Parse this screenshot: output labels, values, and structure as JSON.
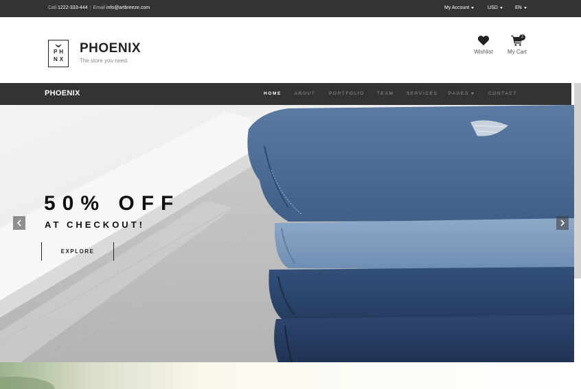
{
  "topbar": {
    "call_label": "Call",
    "phone": "1222-333-444",
    "email_label": "Email",
    "email": "info@artbreeze.com",
    "account": "My Account",
    "currency": "USD",
    "language": "EN"
  },
  "header": {
    "logo_letters": [
      "PH",
      "NX"
    ],
    "brand_name": "PHOENIX",
    "tagline": "The store you need.",
    "wishlist_label": "Wishlist",
    "cart_label": "My Cart",
    "cart_count": "2"
  },
  "nav": {
    "brand": "PHOENIX",
    "items": [
      {
        "label": "HOME",
        "active": true
      },
      {
        "label": "ABOUT"
      },
      {
        "label": "PORTFOLIO"
      },
      {
        "label": "TEAM"
      },
      {
        "label": "SERVICES"
      },
      {
        "label": "PAGES"
      },
      {
        "label": "CONTACT"
      }
    ]
  },
  "hero": {
    "title": "50% OFF",
    "subtitle": "AT CHECKOUT!",
    "button": "EXPLORE"
  },
  "colors": {
    "dark_bar": "#333333",
    "denim_dark": "#2b4163",
    "denim_mid": "#4a6b94",
    "denim_light": "#7f9cbd"
  },
  "icons": [
    "heart-icon",
    "cart-icon",
    "chevron-left-icon",
    "chevron-right-icon",
    "caret-down-icon"
  ]
}
